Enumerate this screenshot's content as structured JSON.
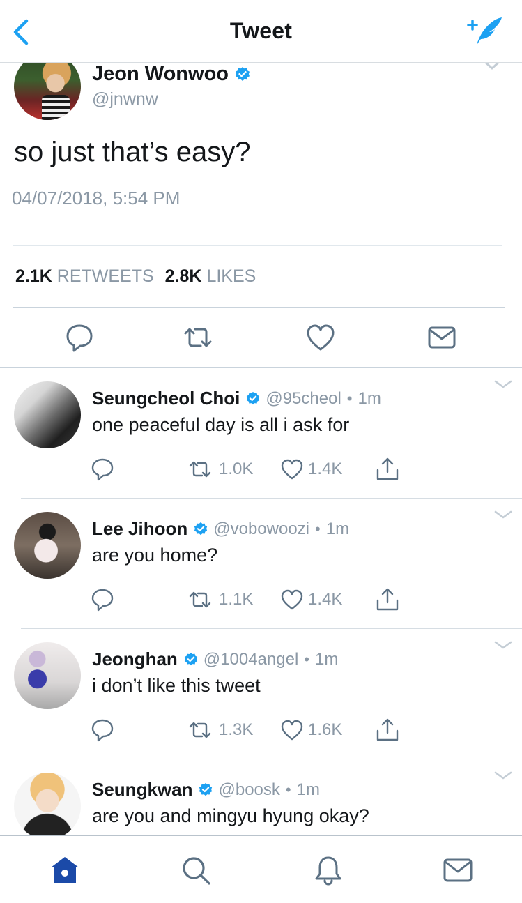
{
  "header": {
    "title": "Tweet",
    "back_icon": "chevron-left-icon",
    "compose_icon": "compose-tweet-icon",
    "accent": "#1da1f2"
  },
  "main_tweet": {
    "name": "Jeon Wonwoo",
    "handle": "@jnwnw",
    "verified": true,
    "text": "so just that’s easy?",
    "timestamp": "04/07/2018, 5:54 PM",
    "retweets_count": "2.1K",
    "retweets_label": "RETWEETS",
    "likes_count": "2.8K",
    "likes_label": "LIKES"
  },
  "replies": [
    {
      "name": "Seungcheol Choi",
      "handle": "@95cheol",
      "time": "1m",
      "text": "one peaceful day is all i ask for",
      "retweets": "1.0K",
      "likes": "1.4K"
    },
    {
      "name": "Lee Jihoon",
      "handle": "@vobowoozi",
      "time": "1m",
      "text": "are you home?",
      "retweets": "1.1K",
      "likes": "1.4K"
    },
    {
      "name": "Jeonghan",
      "handle": "@1004angel",
      "time": "1m",
      "text": "i don’t like this tweet",
      "retweets": "1.3K",
      "likes": "1.6K"
    },
    {
      "name": "Seungkwan",
      "handle": "@boosk",
      "time": "1m",
      "text": "are you and mingyu hyung okay?",
      "retweets": "",
      "likes": ""
    }
  ],
  "tabbar": {
    "tabs": [
      "home-icon",
      "search-icon",
      "notifications-icon",
      "messages-icon"
    ],
    "active_color": "#1b4aa8"
  },
  "colors": {
    "text": "#14171a",
    "muted": "#8b98a5",
    "icon": "#5b7083",
    "verified": "#1da1f2"
  }
}
